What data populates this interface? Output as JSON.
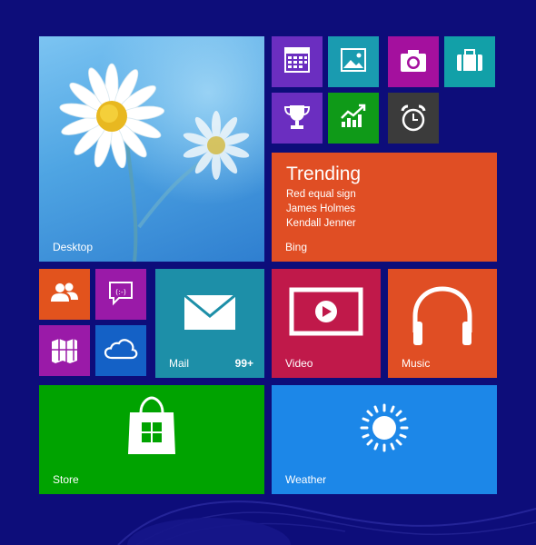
{
  "colors": {
    "background": "#0d0d7a",
    "desktop": "#4a9fe0",
    "bing": "#e04e24",
    "mail": "#1d8fa8",
    "video": "#c0194a",
    "music": "#e04e24",
    "store": "#00a300",
    "weather": "#1c87e8",
    "people": "#e2531d",
    "messaging": "#9a1aa8",
    "maps": "#9a1aa8",
    "skydrive": "#1461c6",
    "calendar": "#6b2ec0",
    "photos": "#1a9bb0",
    "camera": "#a4109e",
    "travel": "#12a0a8",
    "sports": "#6b2ec0",
    "finance": "#0f9a18",
    "alarms": "#3b3b3b"
  },
  "tiles": {
    "desktop": {
      "label": "Desktop"
    },
    "bing": {
      "label": "Bing",
      "title": "Trending",
      "items": [
        "Red equal sign",
        "James Holmes",
        "Kendall Jenner"
      ]
    },
    "mail": {
      "label": "Mail",
      "count": "99+"
    },
    "video": {
      "label": "Video"
    },
    "music": {
      "label": "Music"
    },
    "store": {
      "label": "Store"
    },
    "weather": {
      "label": "Weather"
    }
  },
  "icons": {
    "calendar": "calendar-icon",
    "photos": "photos-icon",
    "camera": "camera-icon",
    "travel": "travel-icon",
    "sports": "trophy-icon",
    "finance": "finance-icon",
    "alarms": "alarm-clock-icon",
    "people": "people-icon",
    "messaging": "messaging-icon",
    "maps": "maps-icon",
    "skydrive": "cloud-icon",
    "mail": "mail-icon",
    "video": "video-icon",
    "music": "headphones-icon",
    "store": "store-bag-icon",
    "weather": "sun-icon"
  }
}
